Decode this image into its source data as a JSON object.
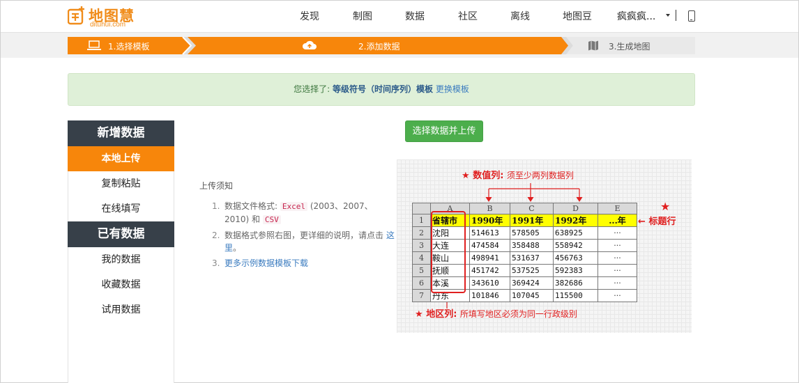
{
  "logo": {
    "text": "地图慧",
    "sub": "dituhui.com"
  },
  "nav": {
    "items": [
      "发现",
      "制图",
      "数据",
      "社区",
      "离线",
      "地图豆"
    ],
    "user": "疯疯疯..."
  },
  "steps": [
    {
      "label": "1.选择模板",
      "icon": "laptop-icon"
    },
    {
      "label": "2.添加数据",
      "icon": "cloud-upload-icon"
    },
    {
      "label": "3.生成地图",
      "icon": "map-icon"
    }
  ],
  "notice": {
    "prefix": "您选择了:",
    "template": "等级符号（时间序列）模板",
    "change": "更换模板"
  },
  "sidebar": {
    "add_header": "新增数据",
    "add_items": [
      "本地上传",
      "复制粘贴",
      "在线填写"
    ],
    "have_header": "已有数据",
    "have_items": [
      "我的数据",
      "收藏数据",
      "试用数据"
    ]
  },
  "main": {
    "upload_button": "选择数据并上传",
    "notes_title": "上传须知",
    "notes": [
      {
        "num": "1.",
        "pre": "数据文件格式:",
        "code1": "Excel",
        "mid": "(2003、2007、2010) 和",
        "code2": "CSV"
      },
      {
        "num": "2.",
        "pre": "数据格式参照右图，更详细的说明，请点击",
        "link": "这里",
        "post": "。"
      },
      {
        "num": "3.",
        "link": "更多示例数据模板下载"
      }
    ]
  },
  "illustration": {
    "top_note": {
      "star": "★",
      "title": "数值列:",
      "desc": "须至少两列数据列"
    },
    "right_note": {
      "star": "★",
      "arrow": "←",
      "title": "标题行"
    },
    "bottom_note": {
      "star": "★",
      "title": "地区列:",
      "desc": "所填写地区必须为同一行政级别"
    },
    "columns": [
      "A",
      "B",
      "C",
      "D",
      "E"
    ],
    "header_row": [
      "省辖市",
      "1990年",
      "1991年",
      "1992年",
      "...年"
    ],
    "rows": [
      [
        "沈阳",
        "514613",
        "578505",
        "638925",
        "···"
      ],
      [
        "大连",
        "474584",
        "358488",
        "558942",
        "···"
      ],
      [
        "鞍山",
        "498941",
        "531637",
        "456763",
        "···"
      ],
      [
        "抚顺",
        "451742",
        "537525",
        "592383",
        "···"
      ],
      [
        "本溪",
        "343610",
        "369424",
        "382686",
        "···"
      ],
      [
        "丹东",
        "101846",
        "107045",
        "115500",
        "···"
      ]
    ],
    "row_numbers": [
      "1",
      "2",
      "3",
      "4",
      "5",
      "6",
      "7"
    ]
  },
  "colors": {
    "brand_orange": "#f08c1a",
    "step_active": "#f7860b",
    "sidebar_dark": "#374049",
    "upload_green": "#4cae4c",
    "notice_bg": "#dff0d8",
    "annotation_red": "#e02020"
  }
}
